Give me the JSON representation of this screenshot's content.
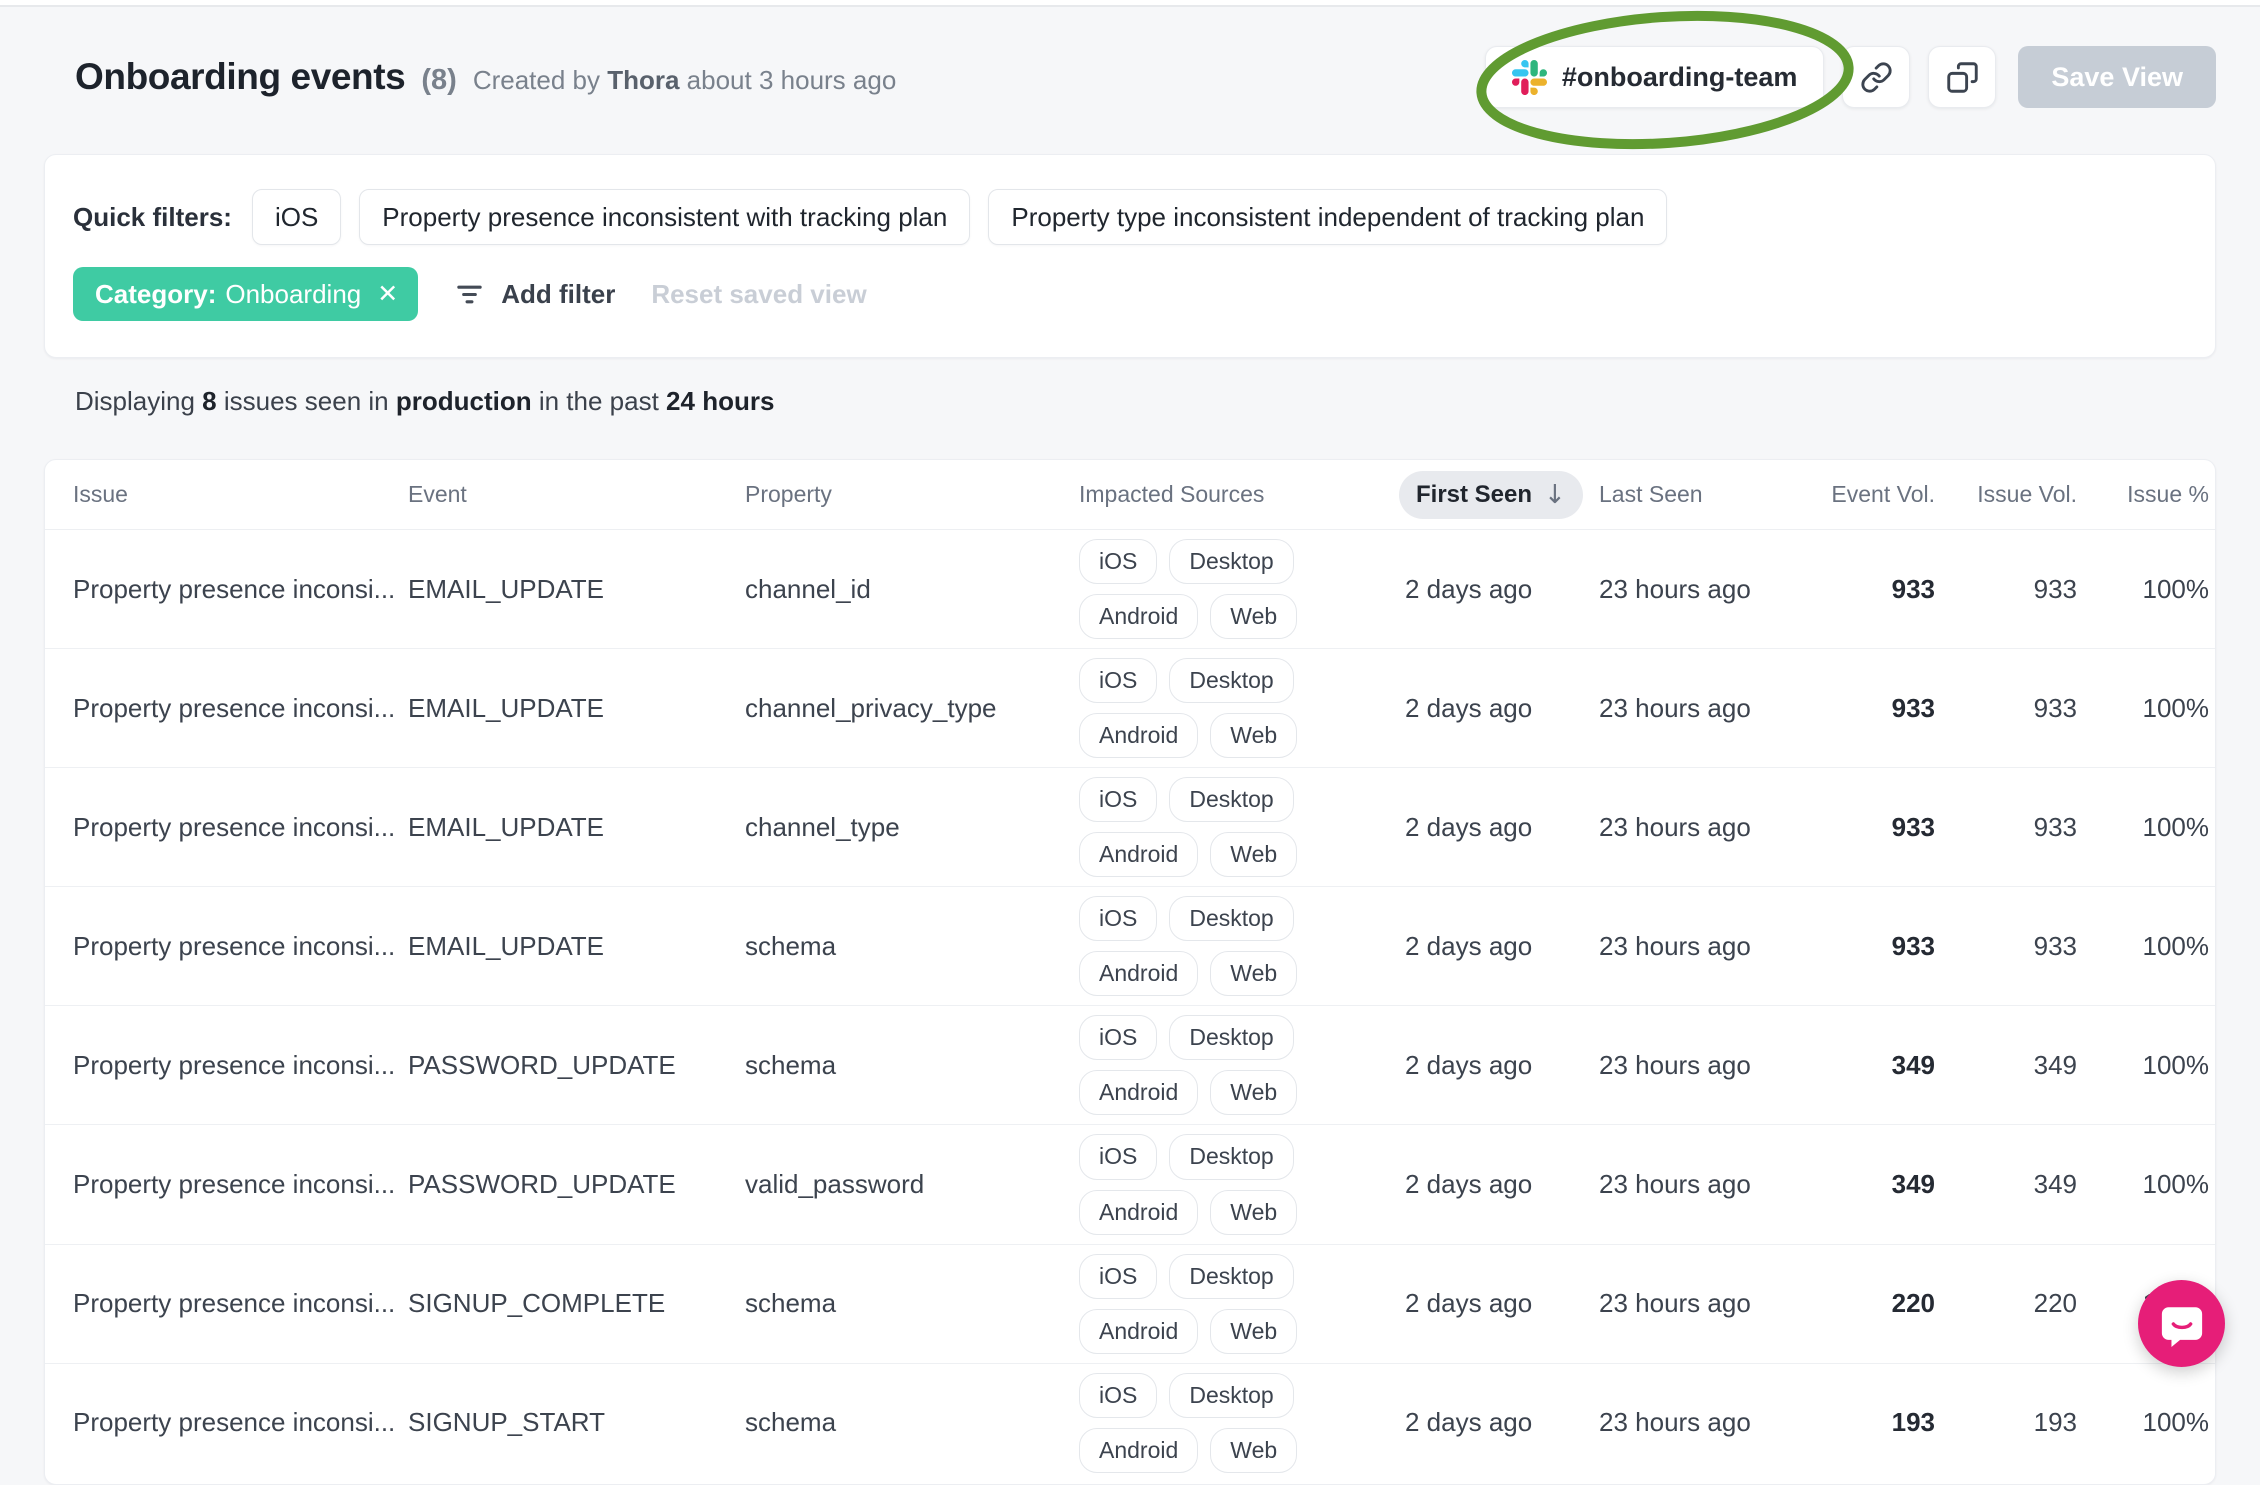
{
  "header": {
    "title": "Onboarding events",
    "count": "(8)",
    "created_prefix": "Created by ",
    "author": "Thora",
    "created_suffix": " about 3 hours ago",
    "slack_channel": "#onboarding-team",
    "save_view_label": "Save View"
  },
  "filters": {
    "quick_filters_label": "Quick filters:",
    "quick_filters": [
      "iOS",
      "Property presence inconsistent with tracking plan",
      "Property type inconsistent independent of tracking plan"
    ],
    "active_filter": {
      "key": "Category:",
      "value": "Onboarding"
    },
    "add_filter_label": "Add filter",
    "reset_label": "Reset saved view"
  },
  "summary": {
    "prefix": "Displaying ",
    "count": "8",
    "mid1": " issues seen in ",
    "env": "production",
    "mid2": " in the past ",
    "range": "24 hours"
  },
  "table": {
    "columns": [
      "Issue",
      "Event",
      "Property",
      "Impacted Sources",
      "First Seen",
      "Last Seen",
      "Event Vol.",
      "Issue Vol.",
      "Issue %"
    ],
    "sorted_by": "First Seen",
    "rows": [
      {
        "issue": "Property presence inconsi...",
        "event": "EMAIL_UPDATE",
        "property": "channel_id",
        "sources": [
          "iOS",
          "Desktop",
          "Android",
          "Web"
        ],
        "first_seen": "2 days ago",
        "last_seen": "23 hours ago",
        "event_vol": "933",
        "issue_vol": "933",
        "issue_pct": "100%"
      },
      {
        "issue": "Property presence inconsi...",
        "event": "EMAIL_UPDATE",
        "property": "channel_privacy_type",
        "sources": [
          "iOS",
          "Desktop",
          "Android",
          "Web"
        ],
        "first_seen": "2 days ago",
        "last_seen": "23 hours ago",
        "event_vol": "933",
        "issue_vol": "933",
        "issue_pct": "100%"
      },
      {
        "issue": "Property presence inconsi...",
        "event": "EMAIL_UPDATE",
        "property": "channel_type",
        "sources": [
          "iOS",
          "Desktop",
          "Android",
          "Web"
        ],
        "first_seen": "2 days ago",
        "last_seen": "23 hours ago",
        "event_vol": "933",
        "issue_vol": "933",
        "issue_pct": "100%"
      },
      {
        "issue": "Property presence inconsi...",
        "event": "EMAIL_UPDATE",
        "property": "schema",
        "sources": [
          "iOS",
          "Desktop",
          "Android",
          "Web"
        ],
        "first_seen": "2 days ago",
        "last_seen": "23 hours ago",
        "event_vol": "933",
        "issue_vol": "933",
        "issue_pct": "100%"
      },
      {
        "issue": "Property presence inconsi...",
        "event": "PASSWORD_UPDATE",
        "property": "schema",
        "sources": [
          "iOS",
          "Desktop",
          "Android",
          "Web"
        ],
        "first_seen": "2 days ago",
        "last_seen": "23 hours ago",
        "event_vol": "349",
        "issue_vol": "349",
        "issue_pct": "100%"
      },
      {
        "issue": "Property presence inconsi...",
        "event": "PASSWORD_UPDATE",
        "property": "valid_password",
        "sources": [
          "iOS",
          "Desktop",
          "Android",
          "Web"
        ],
        "first_seen": "2 days ago",
        "last_seen": "23 hours ago",
        "event_vol": "349",
        "issue_vol": "349",
        "issue_pct": "100%"
      },
      {
        "issue": "Property presence inconsi...",
        "event": "SIGNUP_COMPLETE",
        "property": "schema",
        "sources": [
          "iOS",
          "Desktop",
          "Android",
          "Web"
        ],
        "first_seen": "2 days ago",
        "last_seen": "23 hours ago",
        "event_vol": "220",
        "issue_vol": "220",
        "issue_pct": "100%"
      },
      {
        "issue": "Property presence inconsi...",
        "event": "SIGNUP_START",
        "property": "schema",
        "sources": [
          "iOS",
          "Desktop",
          "Android",
          "Web"
        ],
        "first_seen": "2 days ago",
        "last_seen": "23 hours ago",
        "event_vol": "193",
        "issue_vol": "193",
        "issue_pct": "100%"
      }
    ]
  },
  "icons": {
    "slack": "slack-logo",
    "link": "link-icon",
    "copy": "copy-icon",
    "filter": "filter-lines-icon",
    "close": "✕",
    "sort_desc": "↓",
    "chat": "chat-bubble-icon"
  },
  "colors": {
    "accent_teal": "#3FCBA3",
    "annotation_green": "#609B31",
    "chat_pink": "#E61E78",
    "save_disabled_bg": "#C6CDD6",
    "page_bg": "#F6F7F9"
  }
}
